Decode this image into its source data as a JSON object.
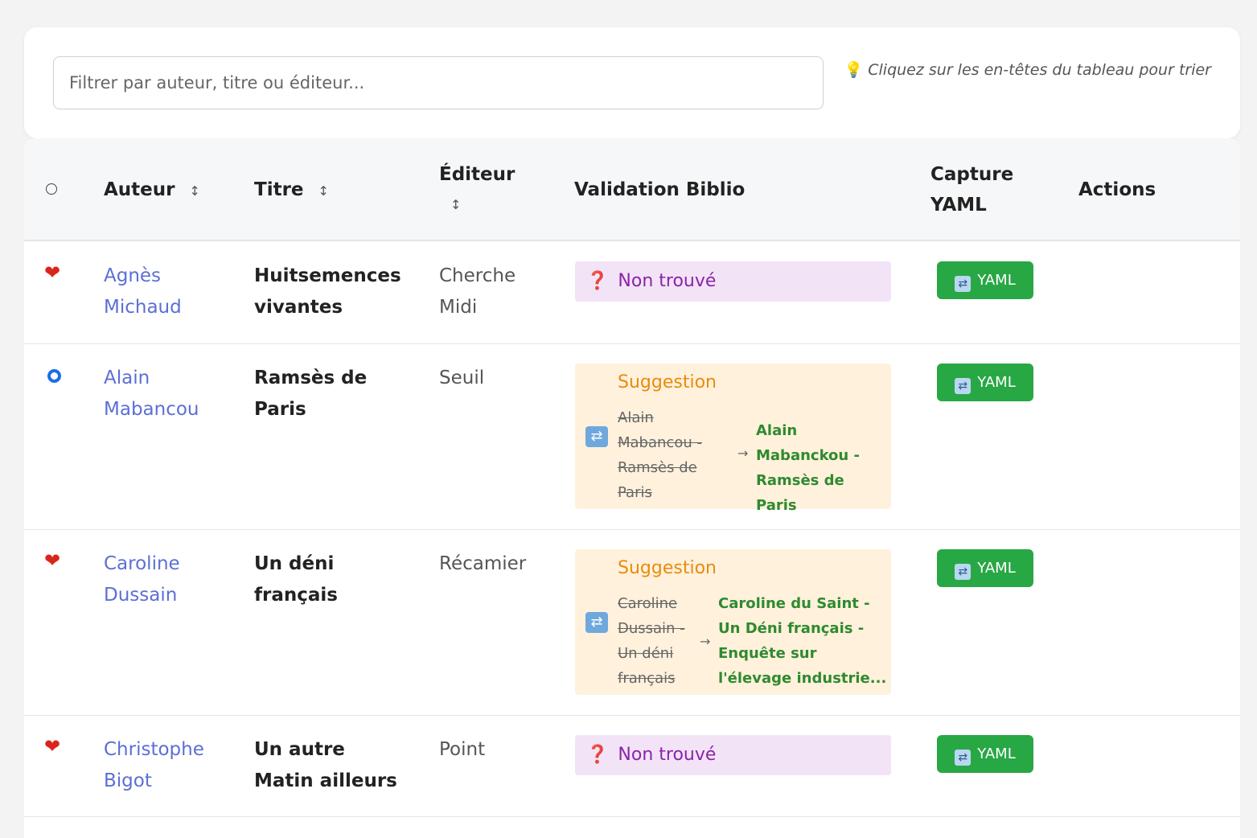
{
  "filter": {
    "placeholder": "Filtrer par auteur, titre ou éditeur...",
    "hint": "Cliquez sur les en-têtes du tableau pour trier"
  },
  "table": {
    "headers": {
      "author": "Auteur",
      "title": "Titre",
      "editor": "Éditeur",
      "validation": "Validation Biblio",
      "capture": "Capture YAML",
      "actions": "Actions",
      "sort_icon": "↕"
    },
    "rows": [
      {
        "status": "heart",
        "author": "Agnès Michaud",
        "title": "Huitsemences vivantes",
        "editor": "Cherche Midi",
        "validation": {
          "type": "not_found",
          "label": "Non trouvé"
        },
        "yaml_label": "YAML"
      },
      {
        "status": "ring",
        "author": "Alain Mabancou",
        "title": "Ramsès de Paris",
        "editor": "Seuil",
        "validation": {
          "type": "suggestion",
          "label": "Suggestion",
          "old": "Alain Mabancou - Ramsès de Paris",
          "new": "Alain Mabanckou - Ramsès de Paris"
        },
        "yaml_label": "YAML"
      },
      {
        "status": "heart",
        "author": "Caroline Dussain",
        "title": "Un déni français",
        "editor": "Récamier",
        "validation": {
          "type": "suggestion",
          "label": "Suggestion",
          "old": "Caroline Dussain - Un déni français",
          "new": "Caroline du Saint - Un Déni français - Enquête sur l'élevage industrie..."
        },
        "yaml_label": "YAML"
      },
      {
        "status": "heart",
        "author": "Christophe Bigot",
        "title": "Un autre Matin ailleurs",
        "editor": "Point",
        "validation": {
          "type": "not_found",
          "label": "Non trouvé"
        },
        "yaml_label": "YAML"
      }
    ]
  },
  "icons": {
    "bulb": "💡",
    "heart": "❤",
    "question": "❓",
    "arrow": "→",
    "refresh": "🔄"
  },
  "colors": {
    "link": "#5b6fd6",
    "heart": "#d9261c",
    "yaml_button": "#28a745",
    "suggestion_bg": "#fff1dc",
    "suggestion_title": "#ea8b0c",
    "suggestion_new": "#2f8a2f",
    "not_found_bg": "#f3e3f7",
    "not_found_text": "#8a24a8"
  }
}
